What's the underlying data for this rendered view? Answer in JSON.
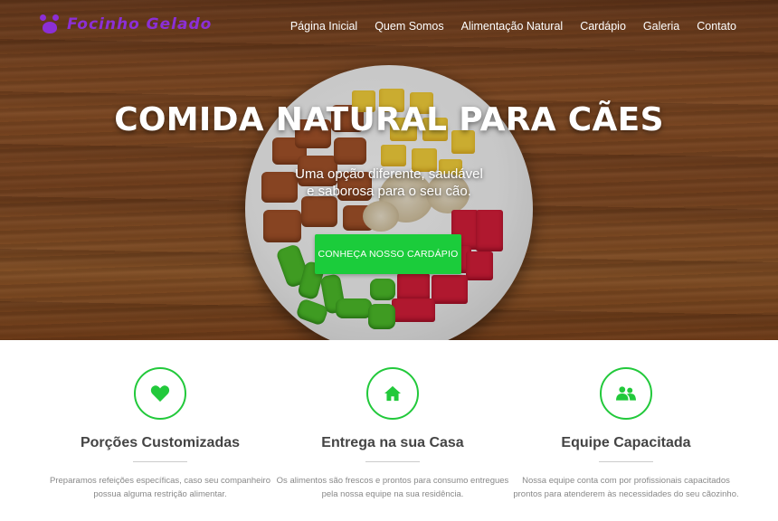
{
  "brand": {
    "name": "Focinho Gelado",
    "color": "#8b2fd6"
  },
  "nav": {
    "items": [
      {
        "label": "Página Inicial"
      },
      {
        "label": "Quem Somos"
      },
      {
        "label": "Alimentação Natural"
      },
      {
        "label": "Cardápio"
      },
      {
        "label": "Galeria"
      },
      {
        "label": "Contato"
      }
    ]
  },
  "hero": {
    "title": "COMIDA NATURAL PARA CÃES",
    "subtitle": "Uma opção diferente, saudável e saborosa para o seu cão.",
    "cta_label": "CONHEÇA NOSSO CARDÁPIO",
    "cta_color": "#1bcc3b"
  },
  "features": [
    {
      "icon": "heart-icon",
      "title": "Porções Customizadas",
      "description": "Preparamos refeições específicas, caso seu companheiro possua alguma restrição alimentar."
    },
    {
      "icon": "home-icon",
      "title": "Entrega na sua Casa",
      "description": "Os alimentos são frescos e prontos para consumo entregues pela nossa equipe na sua residência."
    },
    {
      "icon": "team-icon",
      "title": "Equipe Capacitada",
      "description": "Nossa equipe conta com por profissionais capacitados prontos para atenderem às necessidades do seu cãozinho."
    }
  ],
  "accent_color": "#22c93b"
}
